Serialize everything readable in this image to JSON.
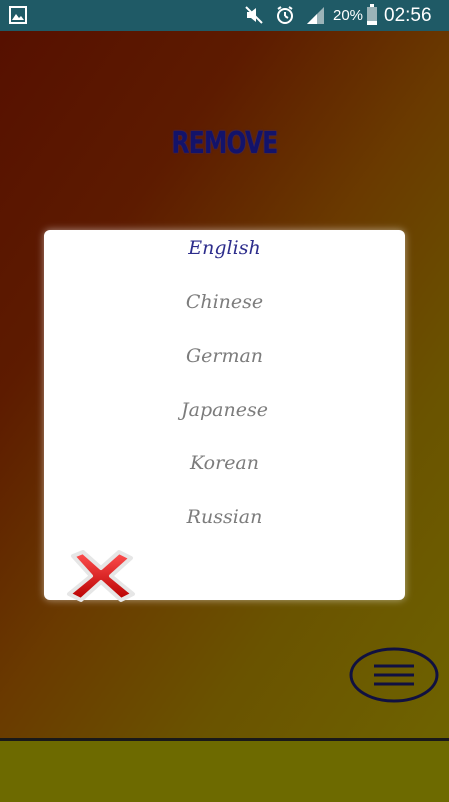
{
  "status_bar": {
    "battery": "20%",
    "time": "02:56",
    "icons": [
      "image-icon",
      "mute-icon",
      "alarm-icon",
      "signal-icon",
      "battery-icon"
    ]
  },
  "screen": {
    "title": "REMOVE",
    "languages": [
      {
        "label": "English",
        "selected": true
      },
      {
        "label": "Chinese",
        "selected": false
      },
      {
        "label": "German",
        "selected": false
      },
      {
        "label": "Japanese",
        "selected": false
      },
      {
        "label": "Korean",
        "selected": false
      },
      {
        "label": "Russian",
        "selected": false
      }
    ],
    "close_icon": "close-x-icon",
    "menu_icon": "menu-icon"
  },
  "colors": {
    "status_bar": "#1f5a66",
    "title": "#13136a",
    "selected_language": "#2d2d8c",
    "language": "#7c7c7c"
  }
}
